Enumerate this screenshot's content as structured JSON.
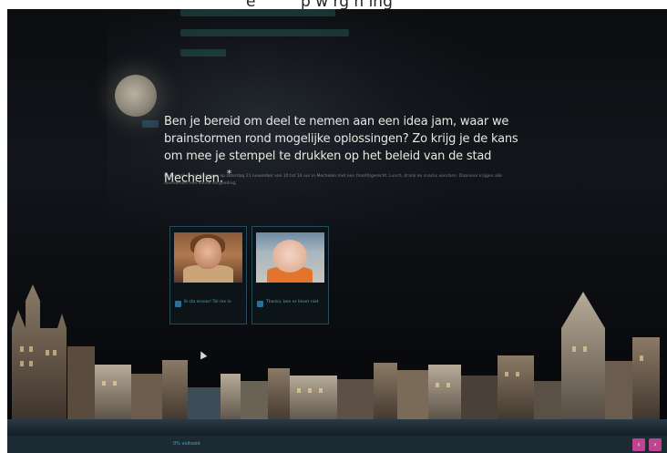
{
  "top_caption": {
    "fragment_left": "e",
    "fragment_right": "p w rg n   ing"
  },
  "question": {
    "headline": "Ben je bereid om deel te nemen aan een idea jam, waar we brainstormen rond mogelijke oplossingen? Zo krijg je de kans om mee je stempel te drukken op het beleid van de stad Mechelen.",
    "required_mark": "*",
    "subtext": "De workshop zal doorgaan op zaterdag 21 november van 10 tot 14 uur in Mechelen met een (hoofd)gerecht. Lunch, drank en snacks voorzien. Daarvoor krijgen alle deelnemers een kleine vergoeding."
  },
  "options": [
    {
      "label": "Ik sta ervoor! Tel me in",
      "icon": "checkbox-icon",
      "image": "woman-portrait"
    },
    {
      "label": "Thanks, ben er liever niet",
      "icon": "checkbox-icon",
      "image": "child-portrait"
    }
  ],
  "footer": {
    "link_text": "0% voltooid"
  },
  "nav": {
    "prev_symbol": "‹",
    "next_symbol": "›"
  },
  "colors": {
    "accent": "#4ea3c7",
    "nav_button": "#c0438f",
    "headline": "#e8e6e0"
  }
}
